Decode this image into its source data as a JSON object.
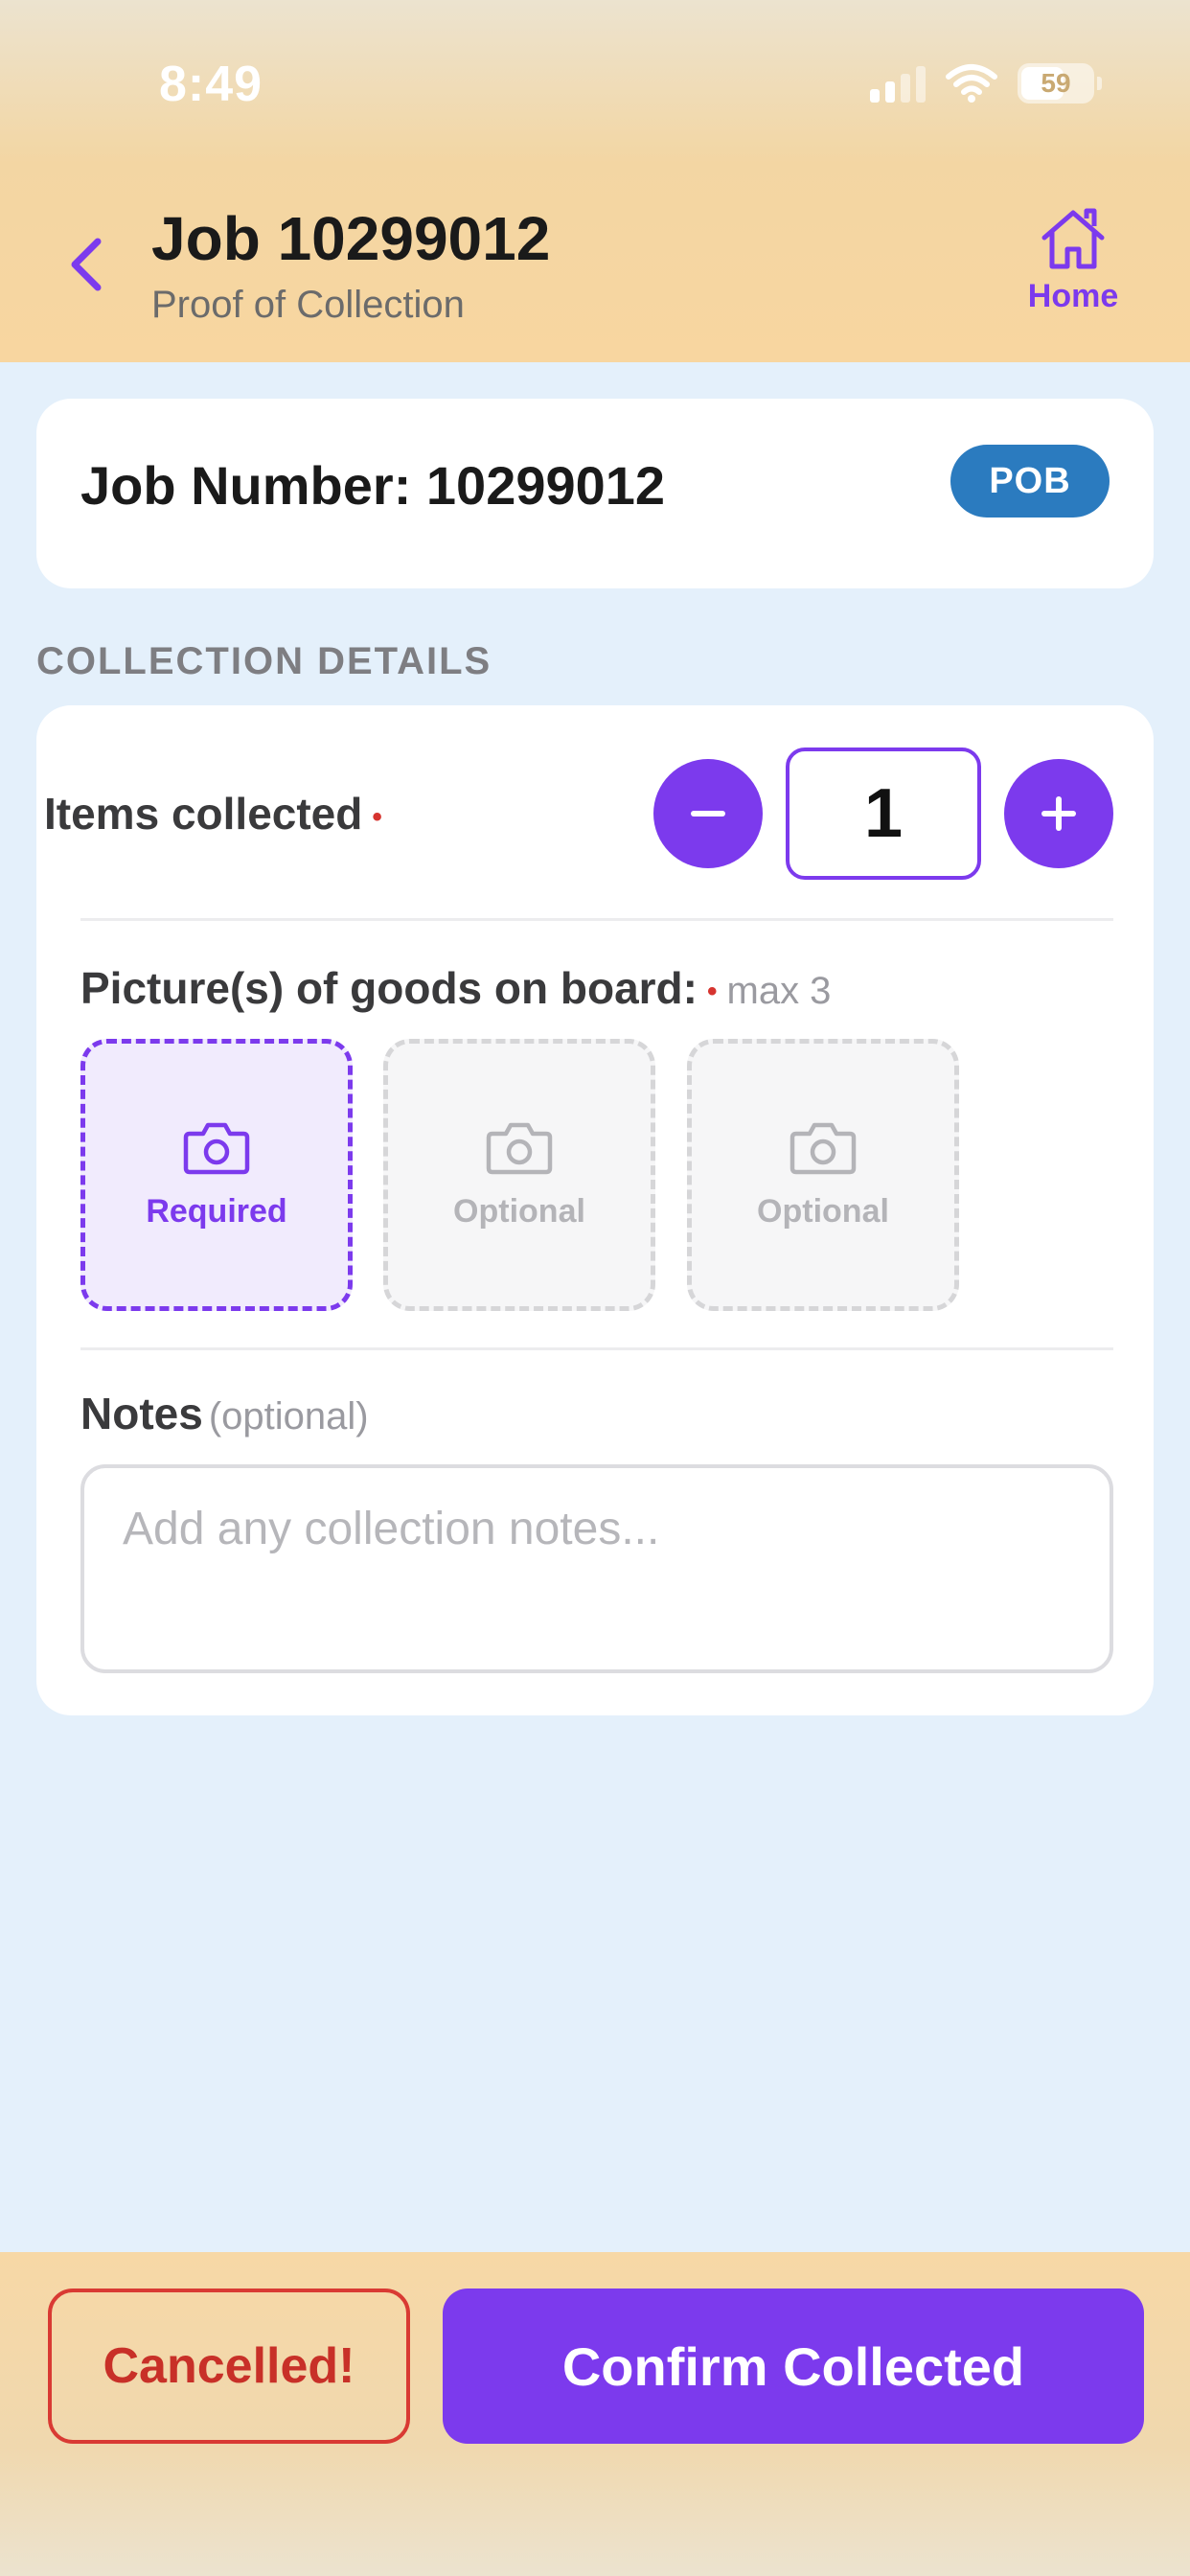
{
  "status_bar": {
    "time": "8:49",
    "battery_level": "59",
    "icons": [
      "signal-icon",
      "wifi-icon",
      "battery-icon"
    ]
  },
  "header": {
    "back_icon": "chevron-left-icon",
    "title": "Job 10299012",
    "subtitle": "Proof of Collection",
    "home_icon": "home-icon",
    "home_label": "Home"
  },
  "job_card": {
    "job_number_text": "Job Number: 10299012",
    "badge": "POB"
  },
  "collection_details": {
    "section_title": "COLLECTION DETAILS",
    "items_collected": {
      "label": "Items collected",
      "required_marker": "•",
      "quantity": "1",
      "decrement_icon": "minus-icon",
      "increment_icon": "plus-icon"
    },
    "pictures": {
      "label": "Picture(s) of goods on board:",
      "required_marker": "•",
      "max_text": "max 3",
      "slots": [
        {
          "label": "Required",
          "icon": "camera-icon"
        },
        {
          "label": "Optional",
          "icon": "camera-icon"
        },
        {
          "label": "Optional",
          "icon": "camera-icon"
        }
      ]
    },
    "notes": {
      "label": "Notes",
      "optional_text": "(optional)",
      "placeholder": "Add any collection notes..."
    }
  },
  "actions": {
    "cancel_label": "Cancelled!",
    "confirm_label": "Confirm Collected"
  },
  "colors": {
    "accent": "#7c3aed",
    "badge": "#2b7bbf",
    "danger": "#d93a33",
    "background": "#e4f0fb"
  }
}
